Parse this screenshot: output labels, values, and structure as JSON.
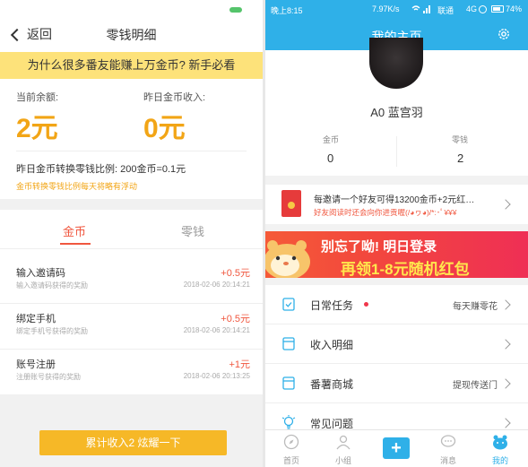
{
  "left": {
    "nav": {
      "back_label": "返回",
      "title": "零钱明细"
    },
    "banner": "为什么很多番友能赚上万金币? 新手必看",
    "summary": {
      "balance_label": "当前余额:",
      "balance_value": "2元",
      "yesterday_label": "昨日金币收入:",
      "yesterday_value": "0元",
      "rate_text": "昨日金币转换零钱比例: 200金币=0.1元",
      "rate_note": "金币转换零钱比例每天将略有浮动"
    },
    "tabs": [
      {
        "label": "金币",
        "active": true
      },
      {
        "label": "零钱",
        "active": false
      }
    ],
    "records": [
      {
        "name": "输入邀请码",
        "desc": "输入邀请码获得的奖励",
        "amount": "+0.5元",
        "time": "2018-02-06 20:14:21"
      },
      {
        "name": "绑定手机",
        "desc": "绑定手机号获得的奖励",
        "amount": "+0.5元",
        "time": "2018-02-06 20:14:21"
      },
      {
        "name": "账号注册",
        "desc": "注册账号获得的奖励",
        "amount": "+1元",
        "time": "2018-02-06 20:13:25"
      }
    ],
    "bottom_button": "累计收入2 炫耀一下",
    "colors": {
      "accent": "#f2a516",
      "red": "#f0573f",
      "banner": "#fde27a",
      "button": "#f6b827"
    }
  },
  "right": {
    "status_bar": {
      "time": "晚上8:15",
      "network_speed": "7.97K/s",
      "carrier": "联通",
      "network_type": "4G",
      "battery": "74%"
    },
    "header": {
      "title": "我的主页",
      "settings_icon": "gear-icon"
    },
    "profile": {
      "name": "A0 蓝宫羽",
      "stats": [
        {
          "label": "金币",
          "value": "0"
        },
        {
          "label": "零钱",
          "value": "2"
        }
      ]
    },
    "invite": {
      "title": "每邀请一个好友可得13200金币+2元红…",
      "subtitle": "好友阅读时还会向你进贡喔(/◕ヮ◕)/*:･ﾟ¥¥¥"
    },
    "ad": {
      "line1": "别忘了呦! 明日登录",
      "line2": "再领1-8元随机红包"
    },
    "menu": [
      {
        "label": "日常任务",
        "right": "每天赚零花",
        "icon": "clipboard-check-icon",
        "dot": true
      },
      {
        "label": "收入明细",
        "right": "",
        "icon": "envelope-icon",
        "dot": false
      },
      {
        "label": "番薯商城",
        "right": "提现传送门",
        "icon": "envelope-icon",
        "dot": false
      },
      {
        "label": "常见问题",
        "right": "",
        "icon": "bulb-icon",
        "dot": false
      }
    ],
    "tabbar": [
      {
        "label": "首页",
        "icon": "compass-icon",
        "active": false
      },
      {
        "label": "小组",
        "icon": "people-icon",
        "active": false
      },
      {
        "label": "",
        "icon": "plus-icon",
        "active": false
      },
      {
        "label": "消息",
        "icon": "chat-bubble-icon",
        "active": false
      },
      {
        "label": "我的",
        "icon": "hamster-icon",
        "active": true
      }
    ],
    "colors": {
      "primary": "#2fb0e8",
      "ad_red": "#f2473d",
      "ad_yellow": "#ffe84d"
    }
  }
}
